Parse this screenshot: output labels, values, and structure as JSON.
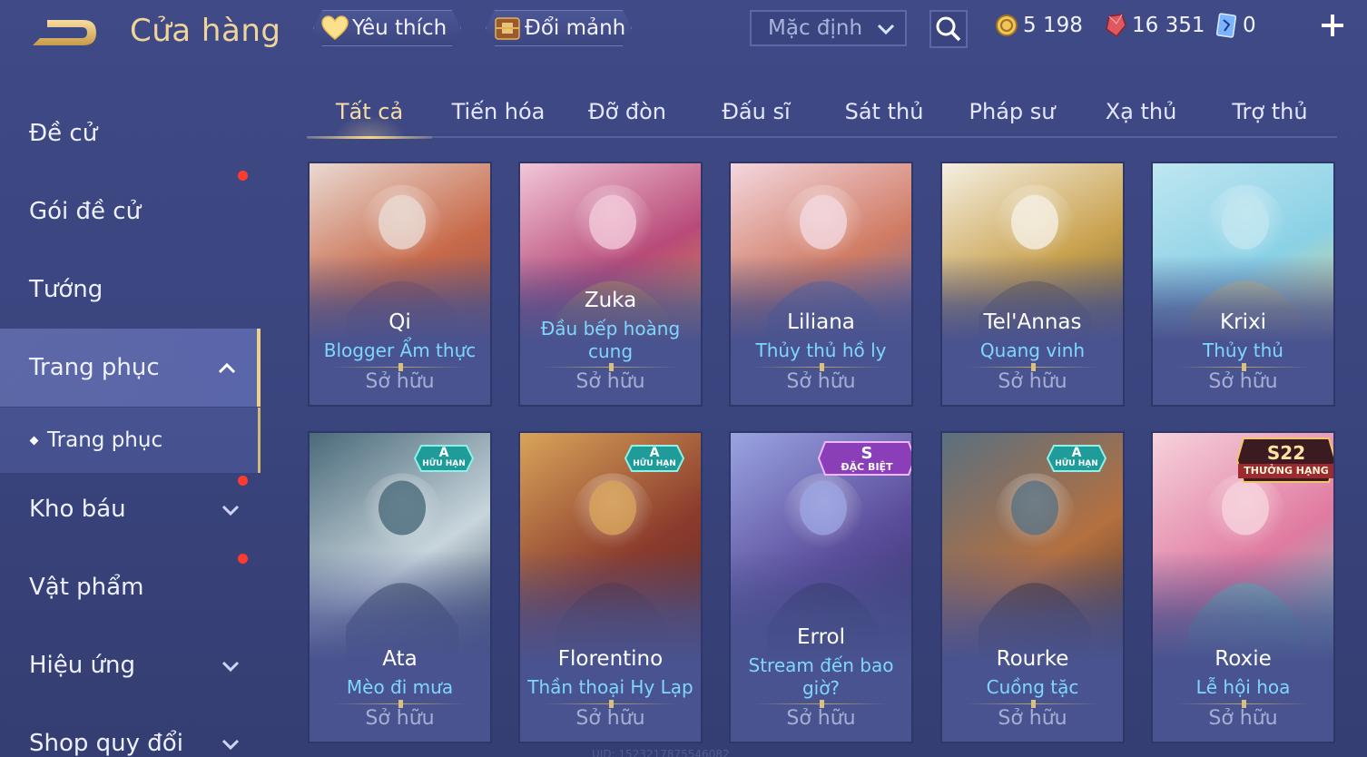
{
  "header": {
    "title": "Cửa hàng",
    "favorites_label": "Yêu thích",
    "exchange_label": "Đổi mảnh",
    "sort_value": "Mặc định",
    "currencies": [
      {
        "name": "gold",
        "value": "5 198",
        "color": "#f2c55a"
      },
      {
        "name": "gems",
        "value": "16 351",
        "color": "#e0585f"
      },
      {
        "name": "tickets",
        "value": "0",
        "color": "#7ab4ff"
      }
    ]
  },
  "sidebar": {
    "items": [
      {
        "label": "Đề cử"
      },
      {
        "label": "Gói đề cử"
      },
      {
        "label": "Tướng"
      },
      {
        "label": "Trang phục"
      },
      {
        "label": "Trang phục"
      },
      {
        "label": "Kho báu"
      },
      {
        "label": "Vật phẩm"
      },
      {
        "label": "Hiệu ứng"
      },
      {
        "label": "Shop quy đổi"
      }
    ]
  },
  "tabs": [
    "Tất cả",
    "Tiến hóa",
    "Đỡ đòn",
    "Đấu sĩ",
    "Sát thủ",
    "Pháp sư",
    "Xạ thủ",
    "Trợ thủ"
  ],
  "skins": [
    {
      "hero": "Qi",
      "skin": "Blogger Ẩm thực",
      "status": "Sở hữu",
      "badge": null,
      "palette": [
        "#e9d9d2",
        "#c86a4a",
        "#8a4d4e"
      ]
    },
    {
      "hero": "Zuka",
      "skin": "Đầu bếp hoàng cung",
      "status": "Sở hữu",
      "badge": null,
      "palette": [
        "#f2c7d8",
        "#b84a78",
        "#d49b4c"
      ]
    },
    {
      "hero": "Liliana",
      "skin": "Thủy thủ hồ ly",
      "status": "Sở hữu",
      "badge": null,
      "palette": [
        "#f3d7df",
        "#d07b64",
        "#5a6aa7"
      ]
    },
    {
      "hero": "Tel'Annas",
      "skin": "Quang vinh",
      "status": "Sở hữu",
      "badge": null,
      "palette": [
        "#f5efe2",
        "#c9a24f",
        "#6b5b3a"
      ]
    },
    {
      "hero": "Krixi",
      "skin": "Thủy thủ",
      "status": "Sở hữu",
      "badge": null,
      "palette": [
        "#bfe6f0",
        "#8ad1e6",
        "#e8d27a"
      ]
    },
    {
      "hero": "Ata",
      "skin": "Mèo đi mưa",
      "status": "Sở hữu",
      "badge": {
        "top": "A",
        "bottom": "HỮU HẠN"
      },
      "palette": [
        "#4a6a7a",
        "#c8d5dc",
        "#2b3c4c"
      ]
    },
    {
      "hero": "Florentino",
      "skin": "Thần thoại Hy Lạp",
      "status": "Sở hữu",
      "badge": {
        "top": "A",
        "bottom": "HỮU HẠN"
      },
      "palette": [
        "#d8a45a",
        "#8b3b2c",
        "#5a2a2a"
      ]
    },
    {
      "hero": "Errol",
      "skin": "Stream đến bao giờ?",
      "status": "Sở hữu",
      "badge": {
        "top": "S",
        "bottom": "ĐẶC BIỆT"
      },
      "palette": [
        "#9aa4e2",
        "#5a4c9a",
        "#2a2f5c"
      ]
    },
    {
      "hero": "Rourke",
      "skin": "Cuồng tặc",
      "status": "Sở hữu",
      "badge": {
        "top": "A",
        "bottom": "HỮU HẠN"
      },
      "palette": [
        "#5a7080",
        "#b47040",
        "#3a2a22"
      ]
    },
    {
      "hero": "Roxie",
      "skin": "Lễ hội hoa",
      "status": "Sở hữu",
      "badge": {
        "top": "S22",
        "bottom": "THƯỞNG HẠNG"
      },
      "palette": [
        "#f6d2dc",
        "#e07aa0",
        "#5fd1c6"
      ]
    }
  ]
}
